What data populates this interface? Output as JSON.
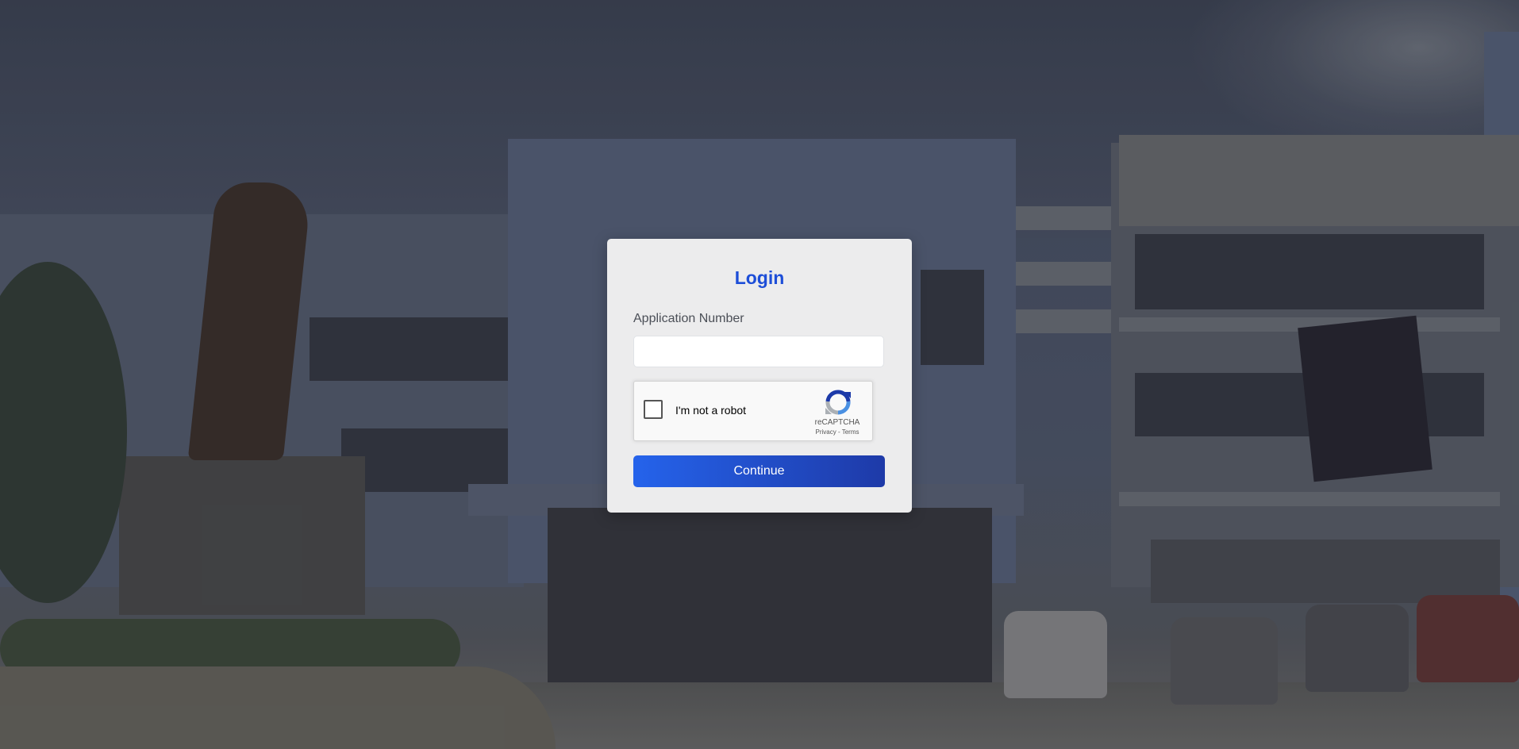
{
  "login": {
    "title": "Login",
    "application_number_label": "Application Number",
    "application_number_value": "",
    "continue_label": "Continue"
  },
  "recaptcha": {
    "checkbox_label": "I'm not a robot",
    "brand": "reCAPTCHA",
    "privacy_link": "Privacy",
    "separator": " - ",
    "terms_link": "Terms",
    "checked": false
  },
  "colors": {
    "accent": "#1d4ed8",
    "button_start": "#2563eb",
    "button_end": "#1e3aa8",
    "card_background": "#ececed"
  },
  "icons": {
    "recaptcha_logo": "recaptcha-logo-icon"
  }
}
